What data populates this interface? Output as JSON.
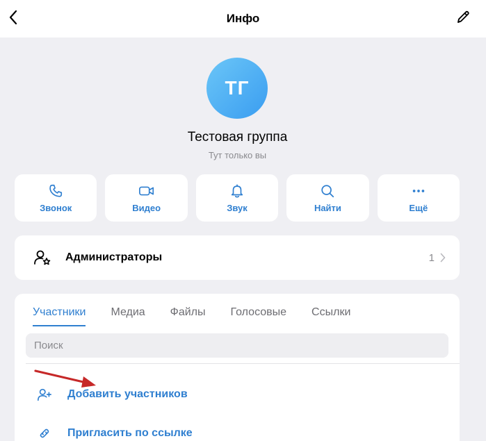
{
  "header": {
    "title": "Инфо"
  },
  "group": {
    "initials": "ТГ",
    "name": "Тестовая группа",
    "subtitle": "Тут только вы"
  },
  "actions": [
    {
      "label": "Звонок",
      "icon": "phone-icon"
    },
    {
      "label": "Видео",
      "icon": "video-icon"
    },
    {
      "label": "Звук",
      "icon": "bell-icon"
    },
    {
      "label": "Найти",
      "icon": "search-icon"
    },
    {
      "label": "Ещё",
      "icon": "more-icon"
    }
  ],
  "admins": {
    "label": "Администраторы",
    "count": "1"
  },
  "tabs": [
    "Участники",
    "Медиа",
    "Файлы",
    "Голосовые",
    "Ссылки"
  ],
  "search": {
    "placeholder": "Поиск"
  },
  "member_actions": [
    {
      "label": "Добавить участников",
      "icon": "add-user-icon"
    },
    {
      "label": "Пригласить по ссылке",
      "icon": "link-icon"
    }
  ],
  "colors": {
    "accent": "#2f7fd0",
    "background": "#efeff3",
    "annotation_arrow": "#c62828"
  }
}
